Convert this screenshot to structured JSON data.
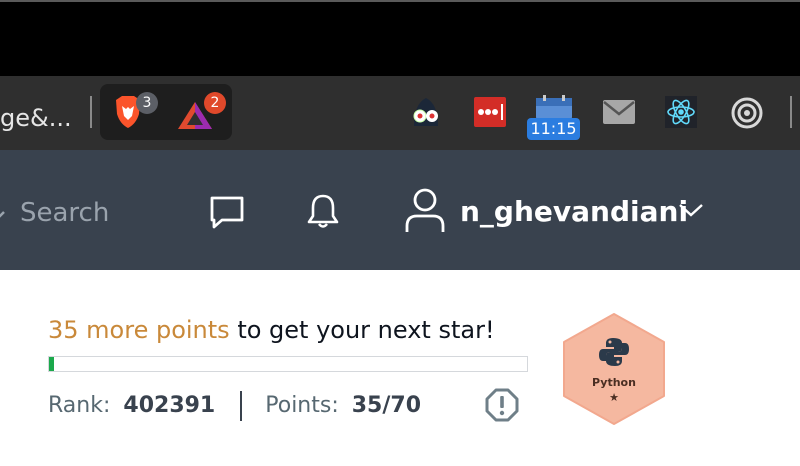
{
  "browser": {
    "url_tail": "ge&...",
    "brave_shield_count": "3",
    "brave_rewards_count": "2",
    "clock_text": "11:15"
  },
  "header": {
    "search_placeholder": "Search",
    "username": "n_ghevandiani"
  },
  "progress": {
    "points_needed": "35 more points",
    "suffix": " to get your next star!",
    "fraction": 0.01
  },
  "stats": {
    "rank_label": "Rank:",
    "rank_value": "402391",
    "points_label": "Points:",
    "points_value": "35/70"
  },
  "badge": {
    "title": "Python",
    "stars": "★",
    "color": "#f5b8a0"
  },
  "colors": {
    "header_bg": "#39424e",
    "accent_orange": "#c9893a",
    "progress_green": "#1ba94c"
  }
}
